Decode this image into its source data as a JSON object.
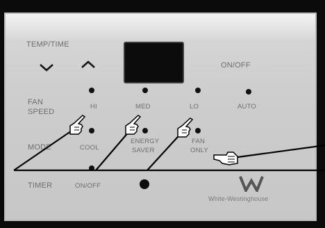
{
  "temp_time": {
    "label": "TEMP/TIME"
  },
  "on_off": {
    "label": "ON/OFF"
  },
  "fan_speed": {
    "label_line1": "FAN",
    "label_line2": "SPEED",
    "options": {
      "hi": "HI",
      "med": "MED",
      "lo": "LO",
      "auto": "AUTO"
    }
  },
  "mode": {
    "label": "MODE",
    "options": {
      "cool": "COOL",
      "energy_saver_line1": "ENERGY",
      "energy_saver_line2": "SAVER",
      "fan_only_line1": "FAN",
      "fan_only_line2": "ONLY"
    }
  },
  "timer": {
    "label": "TIMER",
    "on_off": "ON/OFF"
  },
  "brand": {
    "logo_letter": "W",
    "name": "White-Westinghouse"
  },
  "colors": {
    "panel": "#d0d0d0",
    "label": "#6d6d6d",
    "led": "#111111",
    "frame": "#0b0b0b"
  },
  "icons": [
    "chevron-down-icon",
    "chevron-up-icon",
    "pointing-hand-icon",
    "w-logo-icon"
  ]
}
